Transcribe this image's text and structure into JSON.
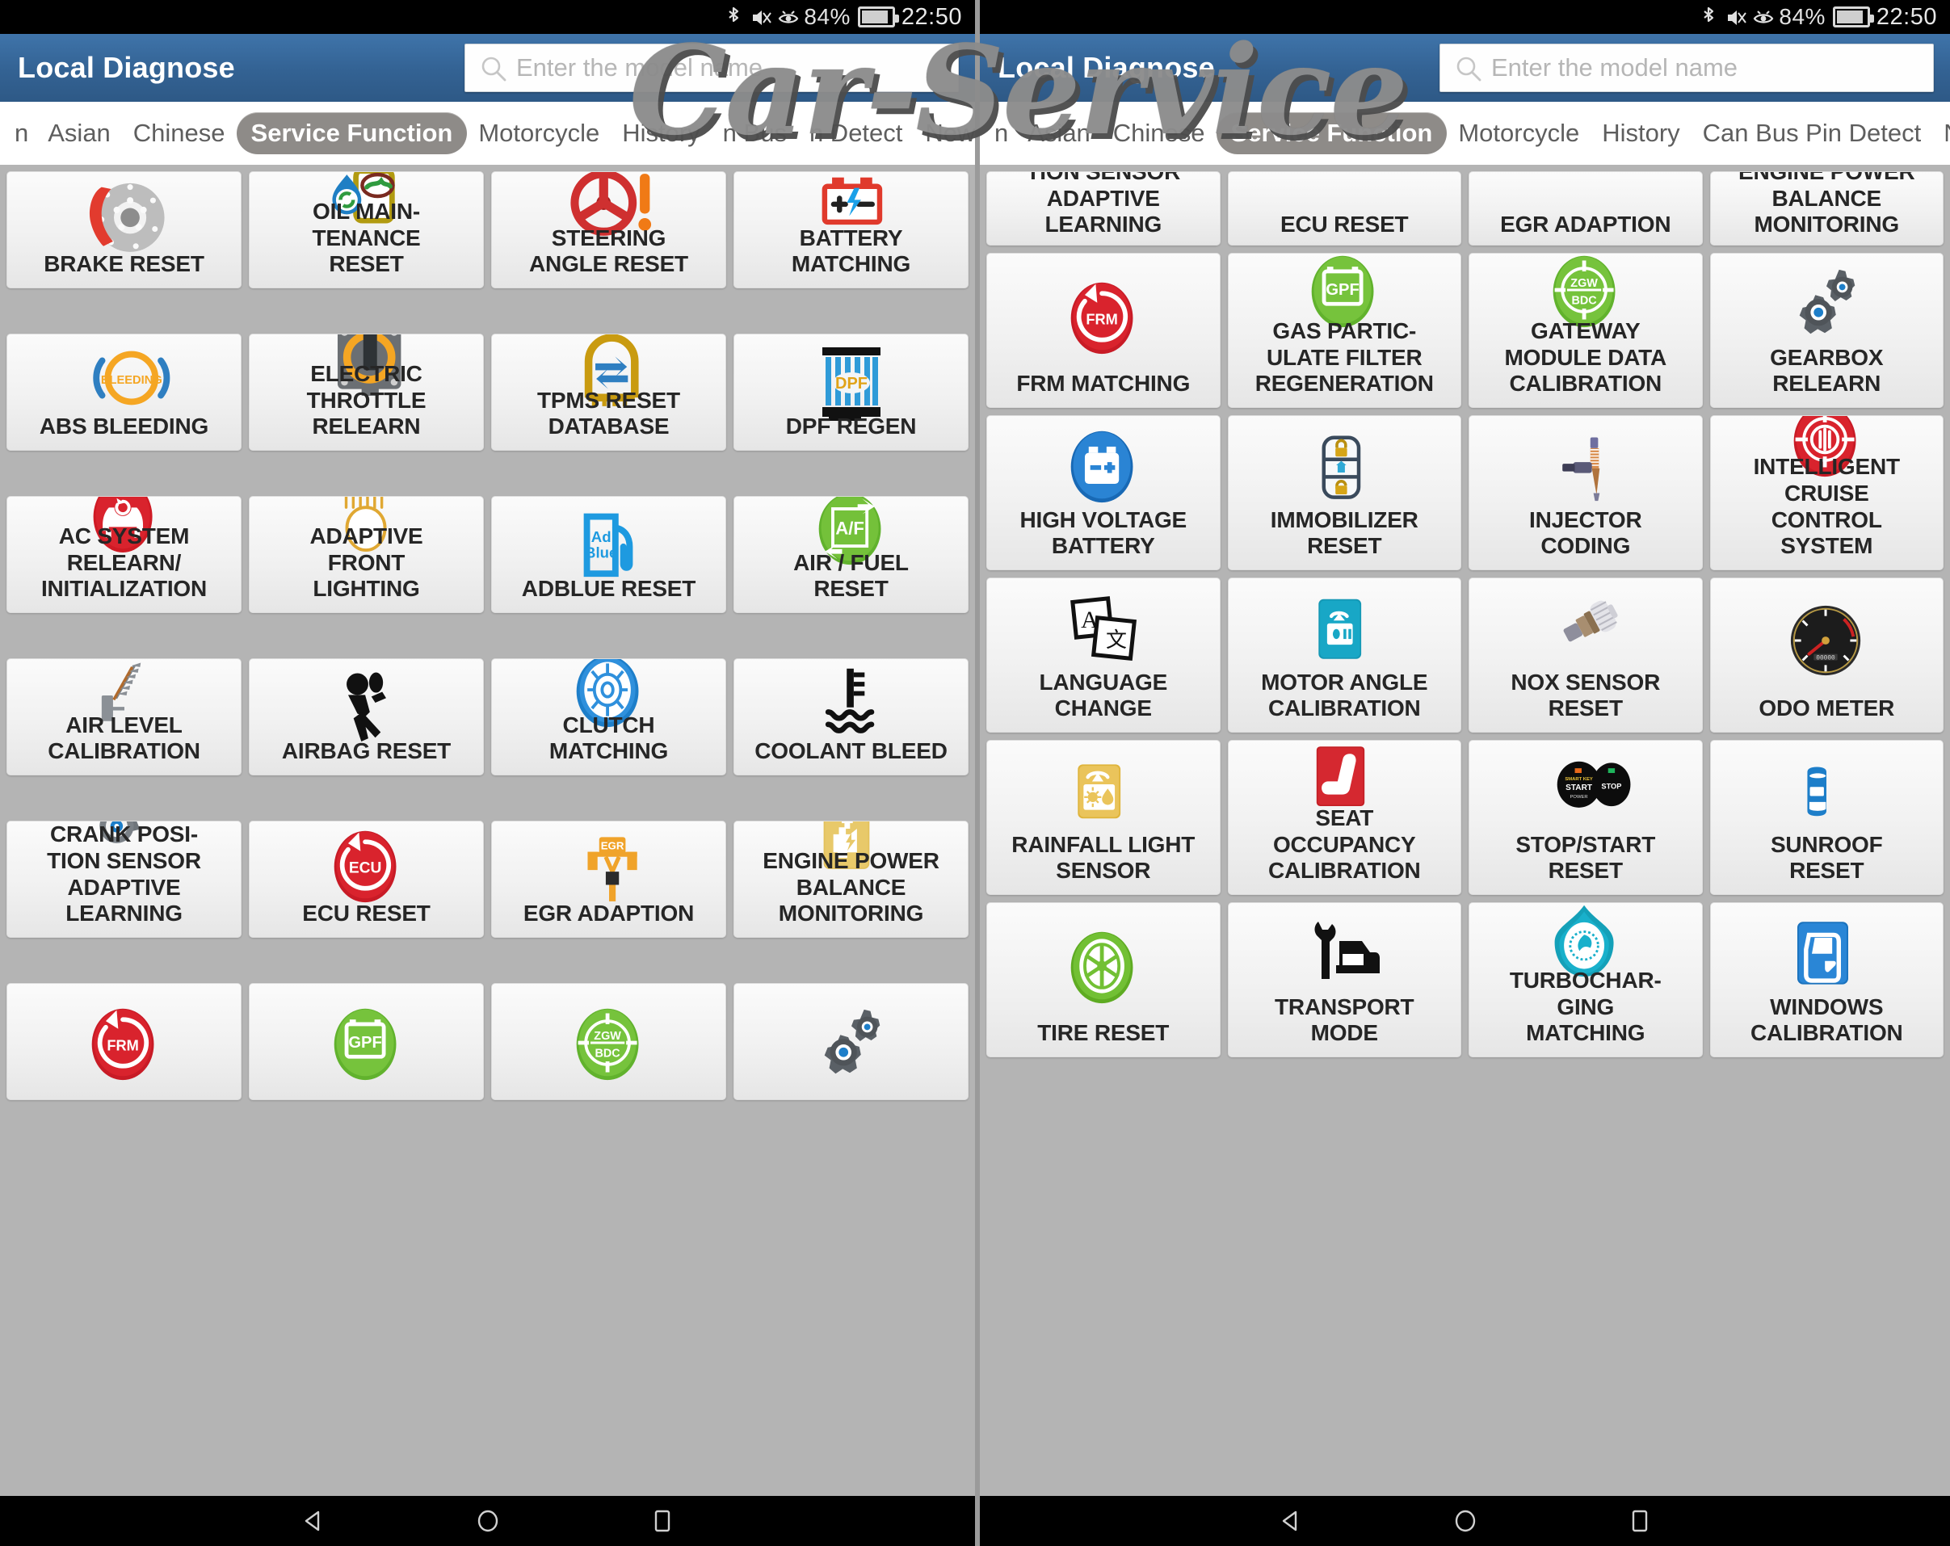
{
  "status_bar": {
    "bluetooth_icon": "bluetooth-icon",
    "mute_icon": "volume-mute-icon",
    "alarm_icon": "eye-care-icon",
    "battery_percent": "84%",
    "battery_icon": "battery-icon",
    "time": "22:50"
  },
  "colors": {
    "appbar_blue": "#336293",
    "active_tab_gray": "#8e8b88",
    "page_bg": "#b4b4b4",
    "tile_bg": "#f3f3f3"
  },
  "watermark": {
    "text": "Car-Service"
  },
  "nav_bar": {
    "back": "back-triangle-icon",
    "home": "home-circle-icon",
    "recents": "recents-square-icon"
  },
  "left_panel": {
    "appbar": {
      "title": "Local Diagnose"
    },
    "search": {
      "placeholder": "Enter the model name",
      "value": "",
      "icon": "search-icon"
    },
    "tabs": [
      {
        "label": "n",
        "active": false,
        "clipped": true
      },
      {
        "label": "Asian",
        "active": false
      },
      {
        "label": "Chinese",
        "active": false
      },
      {
        "label": "Service Function",
        "active": true
      },
      {
        "label": "Motorcycle",
        "active": false
      },
      {
        "label": "History",
        "active": false
      },
      {
        "label": "n Bus",
        "active": false
      },
      {
        "label": "n Detect",
        "active": false
      },
      {
        "label": "New Energy",
        "active": false
      }
    ],
    "tiles": [
      {
        "label": "BRAKE RESET",
        "icon": "brake-disc-icon"
      },
      {
        "label": "OIL MAIN-\nTENANCE\nRESET",
        "icon": "oil-bottle-icon"
      },
      {
        "label": "STEERING\nANGLE RESET",
        "icon": "steering-wheel-warning-icon"
      },
      {
        "label": "BATTERY\nMATCHING",
        "icon": "car-battery-icon"
      },
      {
        "label": "ABS BLEEDING",
        "icon": "abs-bleeding-icon"
      },
      {
        "label": "ELECTRIC\nTHROTTLE\nRELEARN",
        "icon": "throttle-body-icon"
      },
      {
        "label": "TPMS RESET\nDATABASE",
        "icon": "tpms-tire-icon"
      },
      {
        "label": "DPF REGEN",
        "icon": "dpf-filter-icon"
      },
      {
        "label": "AC SYSTEM\nRELEARN/\nINITIALIZATION",
        "icon": "ac-car-reset-icon"
      },
      {
        "label": "ADAPTIVE\nFRONT\nLIGHTING",
        "icon": "headlight-beam-icon"
      },
      {
        "label": "ADBLUE RESET",
        "icon": "adblue-pump-icon"
      },
      {
        "label": "AIR / FUEL\nRESET",
        "icon": "air-fuel-icon"
      },
      {
        "label": "AIR LEVEL\nCALIBRATION",
        "icon": "air-suspension-sensor-icon"
      },
      {
        "label": "AIRBAG RESET",
        "icon": "airbag-crash-dummy-icon"
      },
      {
        "label": "CLUTCH\nMATCHING",
        "icon": "clutch-disc-icon"
      },
      {
        "label": "COOLANT BLEED",
        "icon": "coolant-temp-icon"
      },
      {
        "label": "CRANK POSI-\nTION SENSOR\nADAPTIVE\nLEARNING",
        "icon": "crank-sensor-gear-icon"
      },
      {
        "label": "ECU RESET",
        "icon": "ecu-reset-icon"
      },
      {
        "label": "EGR ADAPTION",
        "icon": "egr-valve-icon"
      },
      {
        "label": "ENGINE POWER\nBALANCE\nMONITORING",
        "icon": "engine-power-icon"
      },
      {
        "label": "",
        "icon": "frm-matching-icon"
      },
      {
        "label": "",
        "icon": "gpf-icon"
      },
      {
        "label": "",
        "icon": "zgw-bdc-icon"
      },
      {
        "label": "",
        "icon": "gearbox-gears-icon"
      }
    ]
  },
  "right_panel": {
    "appbar": {
      "title": "Local Diagnose"
    },
    "search": {
      "placeholder": "Enter the model name",
      "value": "",
      "icon": "search-icon"
    },
    "tabs": [
      {
        "label": "n",
        "active": false,
        "clipped": true
      },
      {
        "label": "Asian",
        "active": false
      },
      {
        "label": "Chinese",
        "active": false
      },
      {
        "label": "Service Function",
        "active": true
      },
      {
        "label": "Motorcycle",
        "active": false
      },
      {
        "label": "History",
        "active": false
      },
      {
        "label": "Can Bus Pin Detect",
        "active": false
      },
      {
        "label": "New Energy",
        "active": false
      }
    ],
    "tiles": [
      {
        "label": "TION SENSOR\nADAPTIVE\nLEARNING",
        "icon": "crank-sensor-gear-icon",
        "cut": true
      },
      {
        "label": "ECU RESET",
        "icon": "ecu-reset-icon",
        "cut": true
      },
      {
        "label": "EGR ADAPTION",
        "icon": "egr-valve-icon",
        "cut": true
      },
      {
        "label": "ENGINE POWER\nBALANCE\nMONITORING",
        "icon": "engine-power-icon",
        "cut": true
      },
      {
        "label": "FRM MATCHING",
        "icon": "frm-matching-icon"
      },
      {
        "label": "GAS PARTIC-\nULATE FILTER\nREGENERATION",
        "icon": "gpf-icon"
      },
      {
        "label": "GATEWAY\nMODULE DATA\nCALIBRATION",
        "icon": "zgw-bdc-icon"
      },
      {
        "label": "GEARBOX\nRELEARN",
        "icon": "gearbox-gears-icon"
      },
      {
        "label": "HIGH VOLTAGE\nBATTERY",
        "icon": "hv-battery-icon"
      },
      {
        "label": "IMMOBILIZER\nRESET",
        "icon": "immobilizer-lock-icon"
      },
      {
        "label": "INJECTOR\nCODING",
        "icon": "injector-icon"
      },
      {
        "label": "INTELLIGENT\nCRUISE\nCONTROL\nSYSTEM",
        "icon": "cruise-radar-icon"
      },
      {
        "label": "LANGUAGE\nCHANGE",
        "icon": "language-translate-icon"
      },
      {
        "label": "MOTOR ANGLE\nCALIBRATION",
        "icon": "motor-angle-icon"
      },
      {
        "label": "NOX SENSOR\nRESET",
        "icon": "nox-sensor-icon"
      },
      {
        "label": "ODO METER",
        "icon": "odometer-gauge-icon"
      },
      {
        "label": "RAINFALL LIGHT\nSENSOR",
        "icon": "rain-light-sensor-icon"
      },
      {
        "label": "SEAT\nOCCUPANCY\nCALIBRATION",
        "icon": "car-seat-icon"
      },
      {
        "label": "STOP/START\nRESET",
        "icon": "stop-start-button-icon"
      },
      {
        "label": "SUNROOF\nRESET",
        "icon": "sunroof-icon"
      },
      {
        "label": "TIRE RESET",
        "icon": "tire-wheel-icon"
      },
      {
        "label": "TRANSPORT\nMODE",
        "icon": "wrench-car-icon"
      },
      {
        "label": "TURBOCHAR-\nGING\nMATCHING",
        "icon": "turbocharger-icon"
      },
      {
        "label": "WINDOWS\nCALIBRATION",
        "icon": "car-door-window-icon"
      }
    ]
  }
}
